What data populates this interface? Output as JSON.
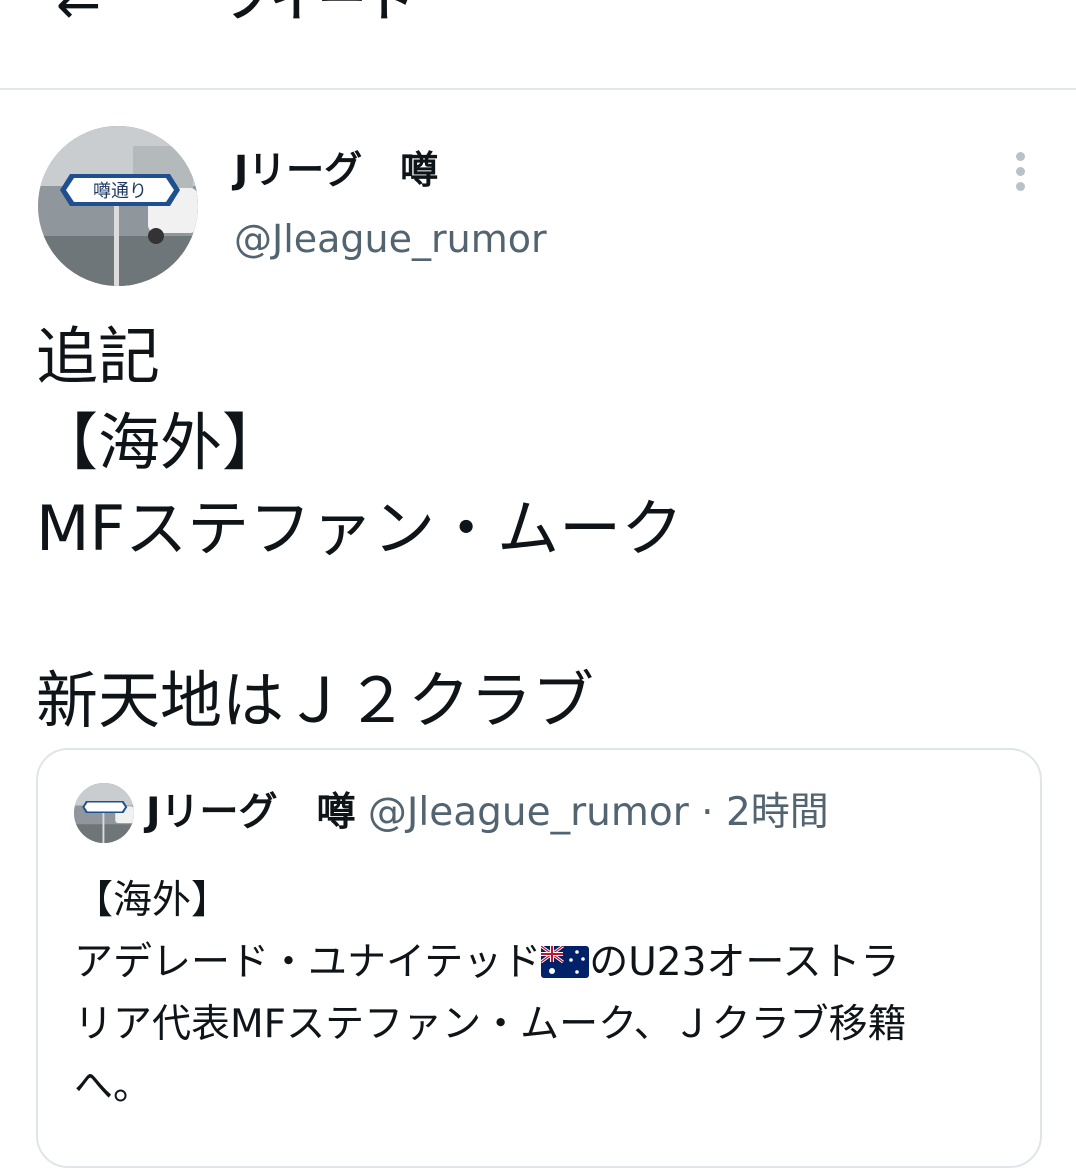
{
  "header": {
    "back_icon": "arrow-left-icon",
    "title": "ツイート"
  },
  "tweet": {
    "author_name": "Jリーグ　噂",
    "author_handle": "@Jleague_rumor",
    "avatar_sign_text": "噂通り",
    "more_icon": "more-vertical-icon",
    "lines": [
      "追記",
      "【海外】",
      "MFステファン・ムーク",
      "",
      "新天地はＪ２クラブ"
    ]
  },
  "quoted_tweet": {
    "author_name": "Jリーグ　噂",
    "author_handle": "@Jleague_rumor",
    "separator": "·",
    "time": "2時間",
    "lines": [
      "【海外】",
      "アデレード・ユナイテッド",
      "のU23オーストラ",
      "リア代表MFステファン・ムーク、Ｊクラブ移籍",
      "へ。"
    ],
    "flag_icon": "australia-flag-icon"
  },
  "colors": {
    "text": "#0f1419",
    "secondary": "#536471",
    "border": "#dfe5e9"
  }
}
